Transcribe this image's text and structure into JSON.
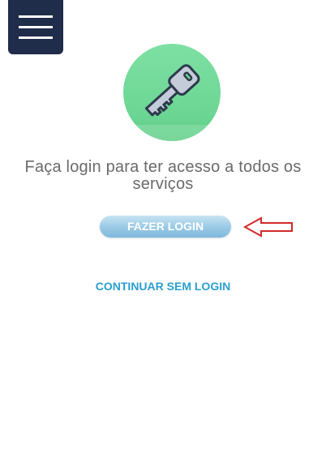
{
  "menu": {
    "icon": "hamburger-menu-icon",
    "color": "#1f2d4a"
  },
  "hero": {
    "icon": "key-icon",
    "badge_color": "#6cd694"
  },
  "message": {
    "line1": "Faça login para ter acesso a todos os",
    "line2": "serviços"
  },
  "actions": {
    "login_label": "FAZER LOGIN",
    "continue_label": "CONTINUAR SEM LOGIN"
  },
  "annotation": {
    "icon": "red-arrow-left-icon",
    "color": "#d22a2a"
  }
}
